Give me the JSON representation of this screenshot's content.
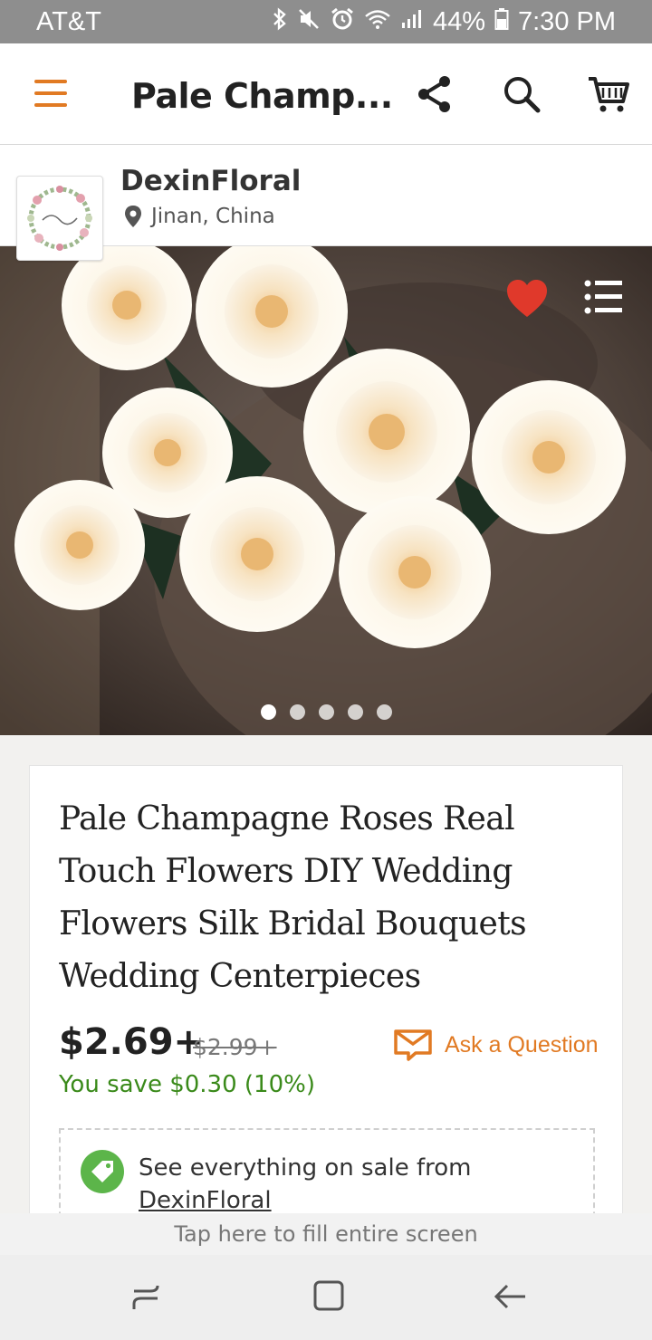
{
  "status_bar": {
    "carrier": "AT&T",
    "battery": "44%",
    "time": "7:30 PM"
  },
  "app_bar": {
    "title": "Pale Champ..."
  },
  "shop": {
    "name": "DexinFloral",
    "location": "Jinan, China"
  },
  "gallery": {
    "image_count": 5,
    "active_index": 0
  },
  "product": {
    "title": "Pale Champagne Roses Real Touch Flowers DIY Wedding Flowers Silk Bridal Bouquets Wedding Centerpieces",
    "price": "$2.69+",
    "original_price": "$2.99+",
    "savings": "You save $0.30 (10%)",
    "ask_question": "Ask a Question",
    "sale_text": "See everything on sale from",
    "sale_shop_link": "DexinFloral"
  },
  "fill_prompt": "Tap here to fill entire screen",
  "colors": {
    "accent_orange": "#e17a23",
    "favorite_red": "#e0392b",
    "savings_green": "#3a8a1a",
    "sale_tag_green": "#5cb54a"
  },
  "icons": [
    "menu-icon",
    "share-icon",
    "search-icon",
    "cart-icon",
    "location-pin-icon",
    "heart-icon",
    "list-icon",
    "mail-icon",
    "price-tag-icon",
    "recents-icon",
    "home-icon",
    "back-icon"
  ]
}
